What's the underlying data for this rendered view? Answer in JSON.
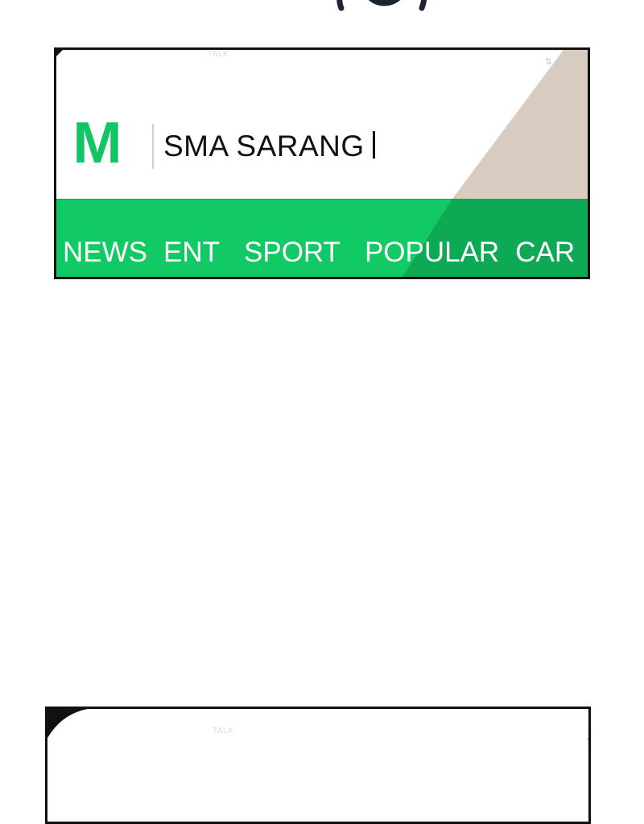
{
  "screen1": {
    "status": {
      "carrier_label": "TALK",
      "data_icon": "data-transfer-icon",
      "signal_icon": "signal-bars-icon"
    },
    "brand": {
      "logo_letter": "M",
      "site_name": "SMA SARANG"
    },
    "nav": {
      "items": [
        {
          "label": "NEWS"
        },
        {
          "label": "ENT"
        },
        {
          "label": "SPORT"
        },
        {
          "label": "POPULAR"
        },
        {
          "label": "CAR"
        }
      ]
    },
    "colors": {
      "accent_green": "#12c563",
      "nav_green": "#11c965",
      "sheen_beige": "#d8cbc0",
      "frame": "#111111"
    }
  },
  "screen2": {
    "status": {
      "carrier_label": "TALK",
      "data_icon": "data-transfer-icon"
    }
  }
}
